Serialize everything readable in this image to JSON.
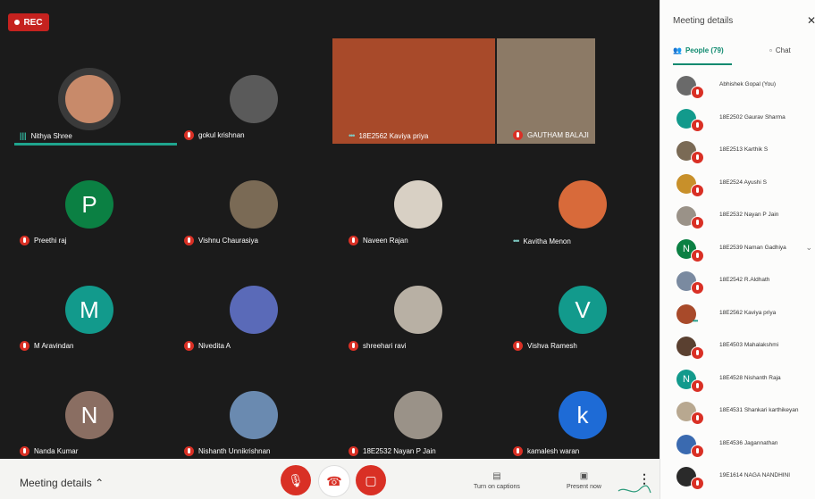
{
  "rec_label": "REC",
  "colors": {
    "grid_bg": "#1b1b1b",
    "accent": "#0f8a6f",
    "mute_red": "#d93025",
    "rec_red": "#c5221f"
  },
  "tiles": [
    {
      "name": "Nithya Shree",
      "indicator": "speaking-bars",
      "avatar": {
        "type": "photo",
        "color": "#c88a6a"
      },
      "speaking": true
    },
    {
      "name": "gokul krishnan",
      "indicator": "mic-off",
      "avatar": {
        "type": "photo",
        "color": "#5a5a5a"
      }
    },
    {
      "name": "18E2562 Kaviya priya",
      "indicator": "dots",
      "avatar": {
        "type": "video",
        "color": "#a84a2a"
      }
    },
    {
      "name": "GAUTHAM BALAJI",
      "indicator": "mic-off",
      "avatar": {
        "type": "video",
        "color": "#8c7a66"
      }
    },
    {
      "name": "Preethi raj",
      "indicator": "mic-off",
      "avatar": {
        "type": "letter",
        "letter": "P",
        "color": "#0b8043"
      }
    },
    {
      "name": "Vishnu Chaurasiya",
      "indicator": "mic-off",
      "avatar": {
        "type": "photo",
        "color": "#7a6a55"
      }
    },
    {
      "name": "Naveen Rajan",
      "indicator": "mic-off",
      "avatar": {
        "type": "photo",
        "color": "#d8d0c4"
      }
    },
    {
      "name": "Kavitha Menon",
      "indicator": "dots",
      "avatar": {
        "type": "photo",
        "color": "#d86a3a"
      }
    },
    {
      "name": "M Aravindan",
      "indicator": "mic-off",
      "avatar": {
        "type": "letter",
        "letter": "M",
        "color": "#129a8c"
      }
    },
    {
      "name": "Nivedita A",
      "indicator": "mic-off",
      "avatar": {
        "type": "photo",
        "color": "#5a6ab8"
      }
    },
    {
      "name": "shreehari ravi",
      "indicator": "mic-off",
      "avatar": {
        "type": "photo",
        "color": "#b8b0a4"
      }
    },
    {
      "name": "Vishva Ramesh",
      "indicator": "mic-off",
      "avatar": {
        "type": "letter",
        "letter": "V",
        "color": "#129a8c"
      }
    },
    {
      "name": "Nanda Kumar",
      "indicator": "mic-off",
      "avatar": {
        "type": "letter",
        "letter": "N",
        "color": "#8a6e62"
      }
    },
    {
      "name": "Nishanth Unnikrishnan",
      "indicator": "mic-off",
      "avatar": {
        "type": "photo",
        "color": "#6a8ab0"
      }
    },
    {
      "name": "18E2532 Nayan P Jain",
      "indicator": "mic-off",
      "avatar": {
        "type": "photo",
        "color": "#9a9288"
      }
    },
    {
      "name": "kamalesh waran",
      "indicator": "mic-off",
      "avatar": {
        "type": "letter",
        "letter": "k",
        "color": "#1e6bd6"
      }
    }
  ],
  "bottom_bar": {
    "meeting_details_label": "Meeting details",
    "captions_label": "Turn on captions",
    "present_label": "Present now"
  },
  "panel": {
    "title": "Meeting details",
    "people_tab": "People (79)",
    "chat_tab": "Chat",
    "participants": [
      {
        "name": "Abhishek Gopal (You)",
        "avatar": {
          "type": "photo",
          "color": "#6a6a6a"
        }
      },
      {
        "name": "18E2502 Gaurav Sharma",
        "avatar": {
          "type": "photo",
          "color": "#129a8c"
        }
      },
      {
        "name": "18E2513 Karthik S",
        "avatar": {
          "type": "photo",
          "color": "#7a6a55"
        }
      },
      {
        "name": "18E2524 Ayushi S",
        "avatar": {
          "type": "photo",
          "color": "#c8902a"
        }
      },
      {
        "name": "18E2532 Nayan P Jain",
        "avatar": {
          "type": "photo",
          "color": "#9a9288"
        }
      },
      {
        "name": "18E2539 Naman Gadhiya",
        "avatar": {
          "type": "letter",
          "letter": "N",
          "color": "#0b8043"
        },
        "chevron": true
      },
      {
        "name": "18E2542 R.Aldhath",
        "avatar": {
          "type": "photo",
          "color": "#7a8aa0"
        }
      },
      {
        "name": "18E2562 Kaviya priya",
        "avatar": {
          "type": "photo",
          "color": "#a84a2a"
        },
        "dots": true
      },
      {
        "name": "18E4503 Mahalakshmi",
        "avatar": {
          "type": "photo",
          "color": "#5a4030"
        }
      },
      {
        "name": "18E4528 Nishanth Raja",
        "avatar": {
          "type": "letter",
          "letter": "N",
          "color": "#129a8c"
        }
      },
      {
        "name": "18E4531 Shankari karthikeyan",
        "avatar": {
          "type": "photo",
          "color": "#b8a890"
        }
      },
      {
        "name": "18E4536 Jagannathan",
        "avatar": {
          "type": "photo",
          "color": "#3a6ab0"
        }
      },
      {
        "name": "19E1614 NAGA NANDHINI",
        "avatar": {
          "type": "photo",
          "color": "#2a2a2a"
        }
      }
    ]
  }
}
